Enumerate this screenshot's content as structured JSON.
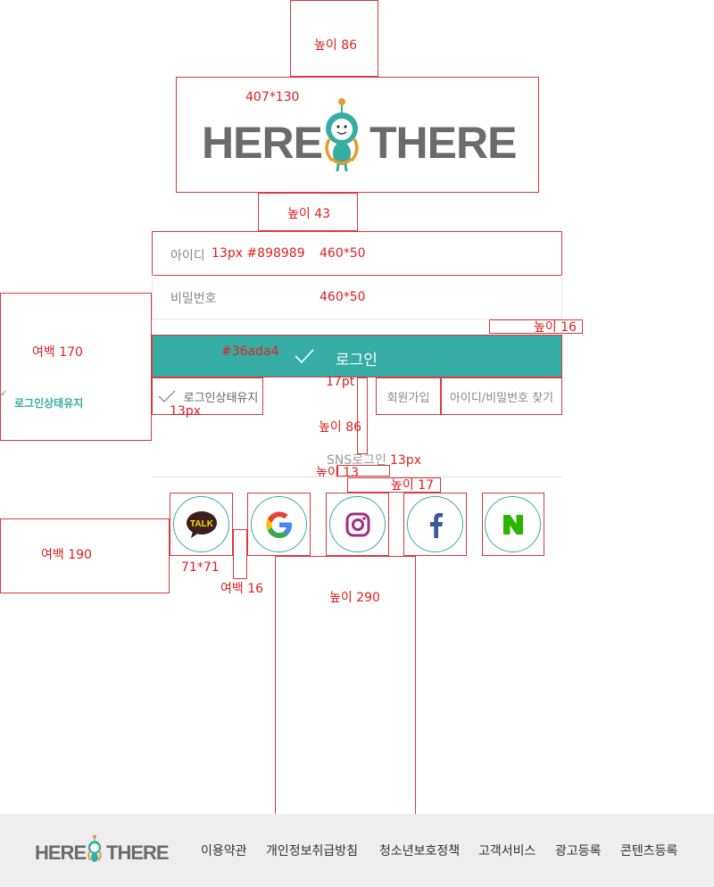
{
  "annotations": {
    "top_height": "높이 86",
    "logo_size": "407*130",
    "gap_height": "높이 43",
    "input_note": "13px #898989",
    "id_size": "460*50",
    "pw_size": "460*50",
    "height_16": "높이 16",
    "margin_170": "여백 170",
    "color_note": "#36ada4",
    "font_17pt": "17pt",
    "font_13px_left": "13px",
    "height_86": "높이 86",
    "sns_font": "13px",
    "height_13": "높이 13",
    "height_17": "높이 17",
    "margin_190": "여백 190",
    "icon_size": "71*71",
    "margin_16": "여백 16",
    "height_290": "높이 290"
  },
  "logo": {
    "left": "HERE",
    "right": "THERE"
  },
  "login_form": {
    "id_label": "아이디",
    "password_label": "비밀번호",
    "login_button": "로그인",
    "keep_login": "로그인상태유지",
    "keep_login_side": "로그인상태유지",
    "signup": "회원가입",
    "find_account": "아이디/비밀번호 찾기"
  },
  "sns": {
    "title": "SNS로그인",
    "kakao_text": "TALK"
  },
  "footer": {
    "logo_left": "HERE",
    "logo_right": "THERE",
    "links": [
      "이용약관",
      "개인정보취급방침",
      "청소년보호정책",
      "고객서비스",
      "광고등록",
      "콘텐츠등록"
    ]
  },
  "colors": {
    "accent": "#36ada4",
    "annotation": "#e02020",
    "input_text": "#898989",
    "logo_gray": "#6b6b6b"
  }
}
